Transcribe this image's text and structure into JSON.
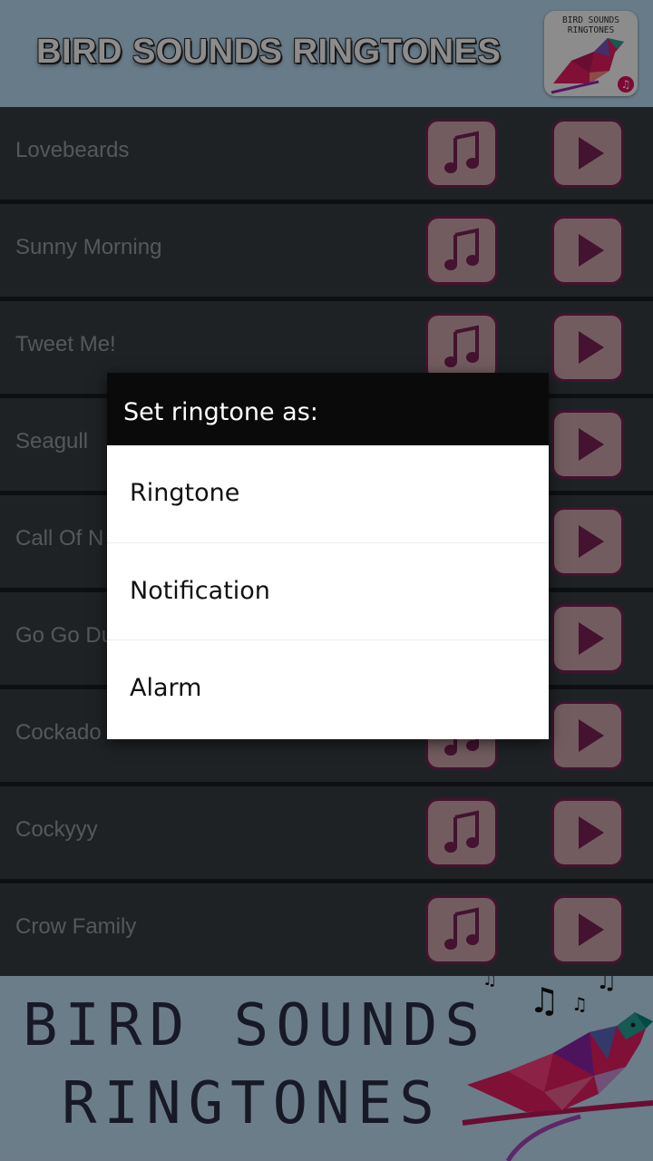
{
  "header": {
    "title": "BIRD SOUNDS RINGTONES",
    "icon_text_line1": "BIRD SOUNDS",
    "icon_text_line2": "RINGTONES"
  },
  "ringtones": [
    {
      "name": "Lovebeards"
    },
    {
      "name": "Sunny Morning"
    },
    {
      "name": "Tweet Me!"
    },
    {
      "name": "Seagull"
    },
    {
      "name": "Call Of N"
    },
    {
      "name": "Go Go Du"
    },
    {
      "name": "Cockado"
    },
    {
      "name": "Cockyyy"
    },
    {
      "name": "Crow Family"
    }
  ],
  "dialog": {
    "title": "Set ringtone as:",
    "options": [
      "Ringtone",
      "Notification",
      "Alarm"
    ]
  },
  "footer": {
    "line1": "BIRD SOUNDS",
    "line2": "RINGTONES"
  },
  "colors": {
    "accent": "#7b2356",
    "button_fill": "#cfa8b0",
    "header_bg": "#bde0f7"
  },
  "icons": {
    "set_ringtone": "music-note-icon",
    "play": "play-icon"
  }
}
